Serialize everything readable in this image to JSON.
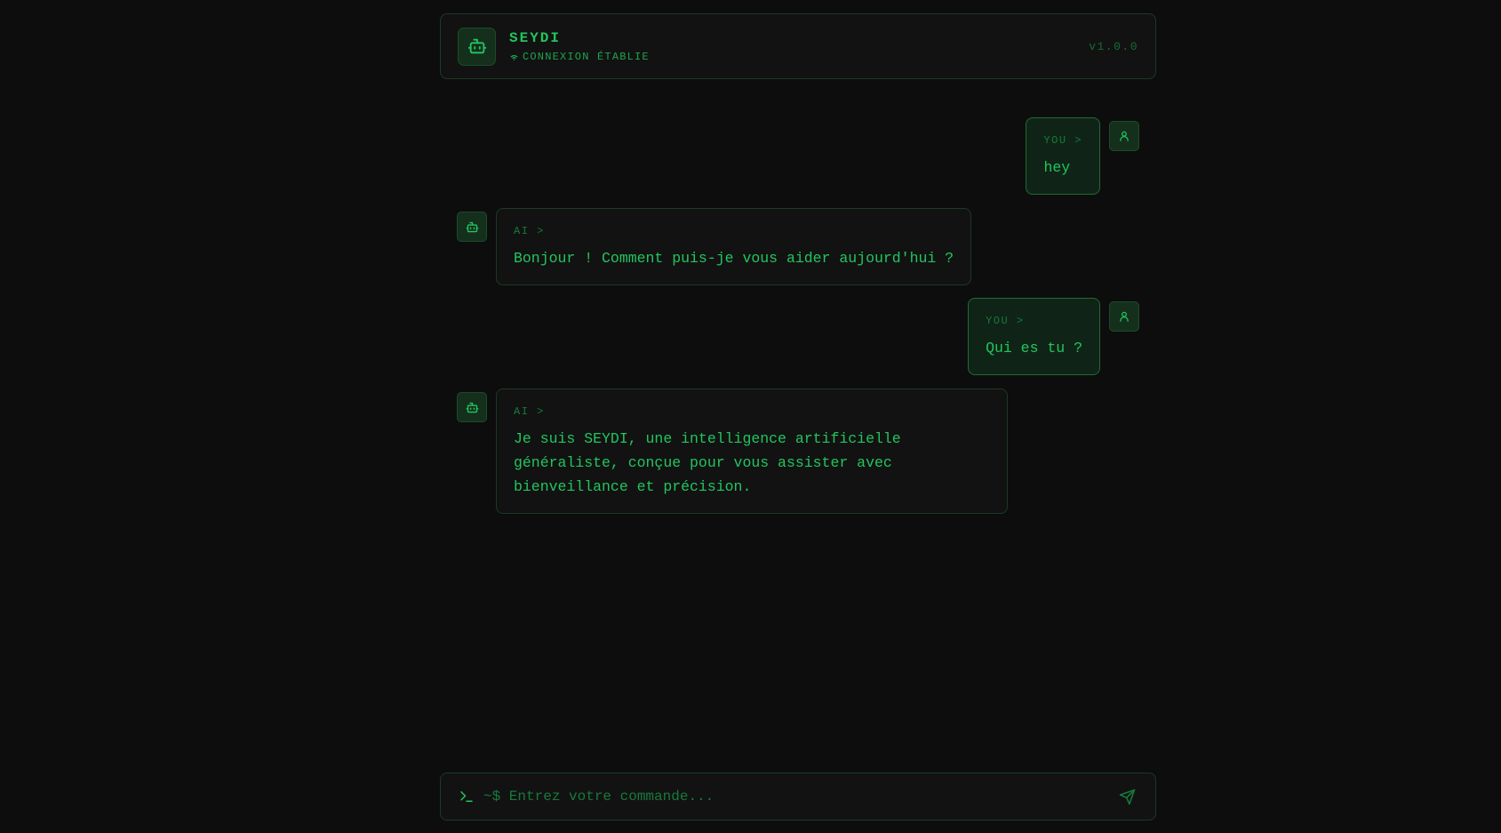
{
  "header": {
    "app_name": "SEYDI",
    "status_text": "CONNEXION ÉTABLIE",
    "version": "v1.0.0",
    "logo_icon": "bot-icon",
    "status_icon": "wifi-icon"
  },
  "messages": [
    {
      "role": "user",
      "role_label": "YOU >",
      "text": "hey",
      "avatar_icon": "user-icon"
    },
    {
      "role": "ai",
      "role_label": "AI >",
      "text": "Bonjour ! Comment puis-je vous aider aujourd'hui ?",
      "avatar_icon": "bot-icon"
    },
    {
      "role": "user",
      "role_label": "YOU >",
      "text": "Qui es tu ?",
      "avatar_icon": "user-icon"
    },
    {
      "role": "ai",
      "role_label": "AI >",
      "text": "Je suis SEYDI, une intelligence artificielle\ngénéraliste, conçue pour vous assister avec\nbienveillance et précision.",
      "avatar_icon": "bot-icon"
    }
  ],
  "input": {
    "value": "",
    "placeholder": "~$ Entrez votre commande...",
    "prompt_icon": "terminal-icon",
    "send_icon": "send-icon"
  },
  "colors": {
    "background": "#0d0d0d",
    "accent": "#22c55e",
    "muted_accent": "#177a3c",
    "border": "#1c3a24"
  }
}
